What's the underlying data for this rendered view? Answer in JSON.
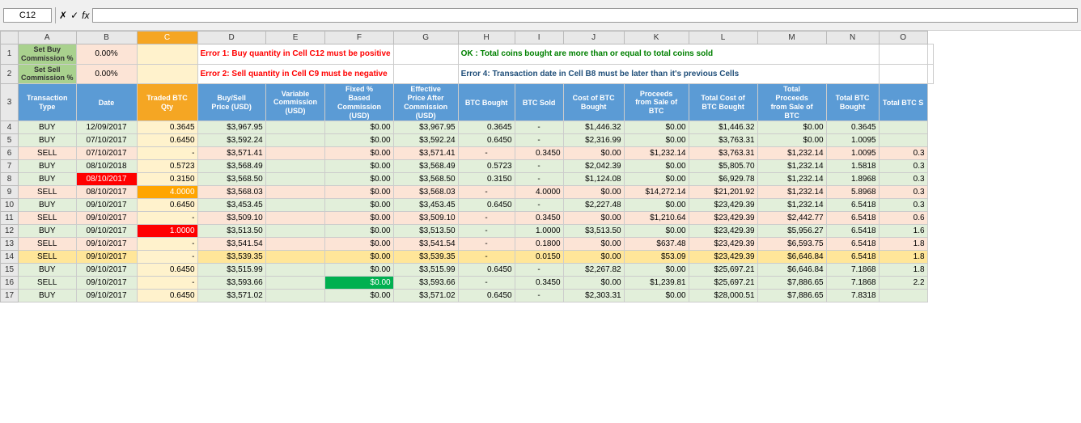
{
  "formula_bar": {
    "name_box": "C12",
    "formula": ""
  },
  "col_headers": [
    "",
    "A",
    "B",
    "C",
    "D",
    "E",
    "F",
    "G",
    "H",
    "I",
    "J",
    "K",
    "L",
    "M",
    "N",
    "O"
  ],
  "row1": {
    "ctrl1_label": "Set Buy\nCommission %",
    "ctrl1_value": "0.00%",
    "error1": "Error 1: Buy quantity in Cell C12 must be positive",
    "ok1": "OK : Total coins bought are more than or equal to total coins sold"
  },
  "row2": {
    "ctrl2_label": "Set Sell\nCommission %",
    "ctrl2_value": "0.00%",
    "error2": "Error 2: Sell quantity in Cell C9 must be negative",
    "error4": "Error 4: Transaction date in Cell B8 must be later than it's previous Cells"
  },
  "table_headers": {
    "transaction_type": "Transaction\nType",
    "date": "Date",
    "traded_btc_qty": "Traded BTC\nQty",
    "buy_sell_price": "Buy/Sell\nPrice (USD)",
    "variable_commission": "Variable\nCommission\n(USD)",
    "fixed_based_commission": "Fixed %\nBased\nCommission\n(USD)",
    "effective_price": "Effective\nPrice After\nCommission\n(USD)",
    "btc_bought": "BTC Bought",
    "btc_sold": "BTC Sold",
    "cost_of_btc_bought": "Cost of BTC\nBought",
    "proceeds_from_sale": "Proceeds\nfrom Sale of\nBTC",
    "total_cost_btc_bought": "Total Cost of\nBTC Bought",
    "total_proceeds": "Total\nProceeds\nfrom Sale of\nBTC",
    "total_btc_bought": "Total BTC\nBought",
    "total_btc": "Total BTC S"
  },
  "rows": [
    {
      "row_num": 4,
      "type": "BUY",
      "date": "12/09/2017",
      "qty": "0.3645",
      "price": "$3,967.95",
      "var_comm": "",
      "fixed_comm": "$0.00",
      "eff_price": "$3,967.95",
      "btc_bought": "0.3645",
      "btc_sold": "-",
      "cost_bought": "$1,446.32",
      "proceeds": "$0.00",
      "total_cost": "$1,446.32",
      "total_proceeds": "$0.00",
      "total_btc_bought": "0.3645",
      "total_btc": "",
      "style": "buy"
    },
    {
      "row_num": 5,
      "type": "BUY",
      "date": "07/10/2017",
      "qty": "0.6450",
      "price": "$3,592.24",
      "var_comm": "",
      "fixed_comm": "$0.00",
      "eff_price": "$3,592.24",
      "btc_bought": "0.6450",
      "btc_sold": "-",
      "cost_bought": "$2,316.99",
      "proceeds": "$0.00",
      "total_cost": "$3,763.31",
      "total_proceeds": "$0.00",
      "total_btc_bought": "1.0095",
      "total_btc": "",
      "style": "buy"
    },
    {
      "row_num": 6,
      "type": "SELL",
      "date": "07/10/2017",
      "qty": "-",
      "price": "$3,571.41",
      "var_comm": "",
      "fixed_comm": "$0.00",
      "eff_price": "$3,571.41",
      "btc_bought": "-",
      "btc_sold": "0.3450",
      "cost_bought": "$0.00",
      "proceeds": "$1,232.14",
      "total_cost": "$3,763.31",
      "total_proceeds": "$1,232.14",
      "total_btc_bought": "1.0095",
      "total_btc": "0.3",
      "style": "sell"
    },
    {
      "row_num": 7,
      "type": "BUY",
      "date": "08/10/2018",
      "qty": "0.5723",
      "price": "$3,568.49",
      "var_comm": "",
      "fixed_comm": "$0.00",
      "eff_price": "$3,568.49",
      "btc_bought": "0.5723",
      "btc_sold": "-",
      "cost_bought": "$2,042.39",
      "proceeds": "$0.00",
      "total_cost": "$5,805.70",
      "total_proceeds": "$1,232.14",
      "total_btc_bought": "1.5818",
      "total_btc": "0.3",
      "style": "buy"
    },
    {
      "row_num": 8,
      "type": "BUY",
      "date": "08/10/2017",
      "qty": "0.3150",
      "price": "$3,568.50",
      "var_comm": "",
      "fixed_comm": "$0.00",
      "eff_price": "$3,568.50",
      "btc_bought": "0.3150",
      "btc_sold": "-",
      "cost_bought": "$1,124.08",
      "proceeds": "$0.00",
      "total_cost": "$6,929.78",
      "total_proceeds": "$1,232.14",
      "total_btc_bought": "1.8968",
      "total_btc": "0.3",
      "style": "buy",
      "date_red": true
    },
    {
      "row_num": 9,
      "type": "SELL",
      "date": "08/10/2017",
      "qty": "4.0000",
      "price": "$3,568.03",
      "var_comm": "",
      "fixed_comm": "$0.00",
      "eff_price": "$3,568.03",
      "btc_bought": "-",
      "btc_sold": "4.0000",
      "cost_bought": "$0.00",
      "proceeds": "$14,272.14",
      "total_cost": "$21,201.92",
      "total_proceeds": "$1,232.14",
      "total_btc_bought": "5.8968",
      "total_btc": "0.3",
      "style": "sell",
      "qty_orange": true
    },
    {
      "row_num": 10,
      "type": "BUY",
      "date": "09/10/2017",
      "qty": "0.6450",
      "price": "$3,453.45",
      "var_comm": "",
      "fixed_comm": "$0.00",
      "eff_price": "$3,453.45",
      "btc_bought": "0.6450",
      "btc_sold": "-",
      "cost_bought": "$2,227.48",
      "proceeds": "$0.00",
      "total_cost": "$23,429.39",
      "total_proceeds": "$1,232.14",
      "total_btc_bought": "6.5418",
      "total_btc": "0.3",
      "style": "buy"
    },
    {
      "row_num": 11,
      "type": "SELL",
      "date": "09/10/2017",
      "qty": "-",
      "price": "$3,509.10",
      "var_comm": "",
      "fixed_comm": "$0.00",
      "eff_price": "$3,509.10",
      "btc_bought": "-",
      "btc_sold": "0.3450",
      "cost_bought": "$0.00",
      "proceeds": "$1,210.64",
      "total_cost": "$23,429.39",
      "total_proceeds": "$2,442.77",
      "total_btc_bought": "6.5418",
      "total_btc": "0.6",
      "style": "sell"
    },
    {
      "row_num": 12,
      "type": "BUY",
      "date": "09/10/2017",
      "qty": "1.0000",
      "price": "$3,513.50",
      "var_comm": "",
      "fixed_comm": "$0.00",
      "eff_price": "$3,513.50",
      "btc_bought": "-",
      "btc_sold": "1.0000",
      "cost_bought": "$3,513.50",
      "proceeds": "$0.00",
      "total_cost": "$23,429.39",
      "total_proceeds": "$5,956.27",
      "total_btc_bought": "6.5418",
      "total_btc": "1.6",
      "style": "buy",
      "qty_red": true
    },
    {
      "row_num": 13,
      "type": "SELL",
      "date": "09/10/2017",
      "qty": "-",
      "price": "$3,541.54",
      "var_comm": "",
      "fixed_comm": "$0.00",
      "eff_price": "$3,541.54",
      "btc_bought": "-",
      "btc_sold": "0.1800",
      "cost_bought": "$0.00",
      "proceeds": "$637.48",
      "total_cost": "$23,429.39",
      "total_proceeds": "$6,593.75",
      "total_btc_bought": "6.5418",
      "total_btc": "1.8",
      "style": "sell"
    },
    {
      "row_num": 14,
      "type": "SELL",
      "date": "09/10/2017",
      "qty": "-",
      "price": "$3,539.35",
      "var_comm": "",
      "fixed_comm": "$0.00",
      "eff_price": "$3,539.35",
      "btc_bought": "-",
      "btc_sold": "0.0150",
      "cost_bought": "$0.00",
      "proceeds": "$53.09",
      "total_cost": "$23,429.39",
      "total_proceeds": "$6,646.84",
      "total_btc_bought": "6.5418",
      "total_btc": "1.8",
      "style": "row14"
    },
    {
      "row_num": 15,
      "type": "BUY",
      "date": "09/10/2017",
      "qty": "0.6450",
      "price": "$3,515.99",
      "var_comm": "",
      "fixed_comm": "$0.00",
      "eff_price": "$3,515.99",
      "btc_bought": "0.6450",
      "btc_sold": "-",
      "cost_bought": "$2,267.82",
      "proceeds": "$0.00",
      "total_cost": "$25,697.21",
      "total_proceeds": "$6,646.84",
      "total_btc_bought": "7.1868",
      "total_btc": "1.8",
      "style": "buy"
    },
    {
      "row_num": 16,
      "type": "SELL",
      "date": "09/10/2017",
      "qty": "-",
      "price": "$3,593.66",
      "var_comm": "",
      "fixed_comm": "$0.00",
      "eff_price": "$3,593.66",
      "btc_bought": "-",
      "btc_sold": "0.3450",
      "cost_bought": "$0.00",
      "proceeds": "$1,239.81",
      "total_cost": "$25,697.21",
      "total_proceeds": "$7,886.65",
      "total_btc_bought": "7.1868",
      "total_btc": "2.2",
      "style": "sell-green"
    },
    {
      "row_num": 17,
      "type": "BUY",
      "date": "09/10/2017",
      "qty": "0.6450",
      "price": "$3,571.02",
      "var_comm": "",
      "fixed_comm": "$0.00",
      "eff_price": "$3,571.02",
      "btc_bought": "0.6450",
      "btc_sold": "-",
      "cost_bought": "$2,303.31",
      "proceeds": "$0.00",
      "total_cost": "$28,000.51",
      "total_proceeds": "$7,886.65",
      "total_btc_bought": "7.8318",
      "total_btc": "",
      "style": "buy"
    }
  ]
}
